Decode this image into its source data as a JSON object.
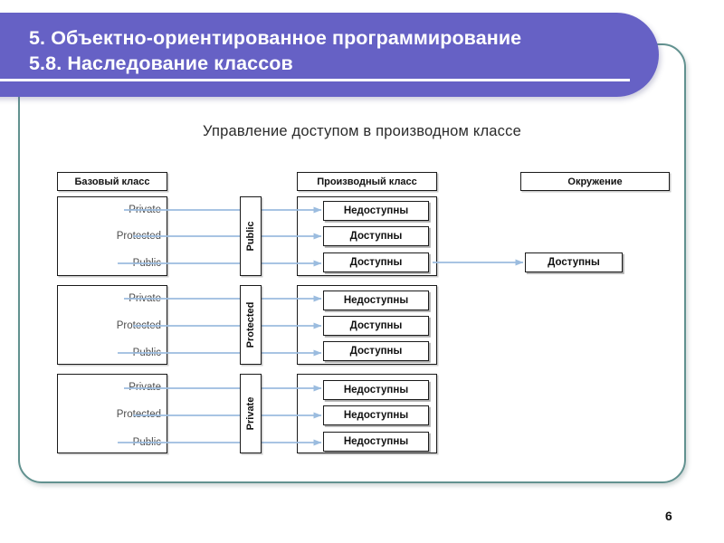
{
  "slide": {
    "page_number": "6",
    "accent_purple": "#6661C5",
    "frame_teal": "#61918F",
    "arrow_blue": "#9BBCDF"
  },
  "header": {
    "title": "5. Объектно-ориентированное программирование\n5.8. Наследование классов",
    "line1": "5. Объектно-ориентированное программирование",
    "line2": "5.8. Наследование классов"
  },
  "diagram": {
    "subtitle": "Управление доступом в производном классе",
    "columns": {
      "base": "Базовый класс",
      "derived": "Производный класс",
      "environment": "Окружение"
    },
    "base_members": [
      "Private",
      "Protected",
      "Public"
    ],
    "groups": [
      {
        "mode": "Public",
        "results": [
          "Недоступны",
          "Доступны",
          "Доступны"
        ]
      },
      {
        "mode": "Protected",
        "results": [
          "Недоступны",
          "Доступны",
          "Доступны"
        ]
      },
      {
        "mode": "Private",
        "results": [
          "Недоступны",
          "Недоступны",
          "Недоступны"
        ]
      }
    ],
    "environment_result": "Доступны"
  }
}
